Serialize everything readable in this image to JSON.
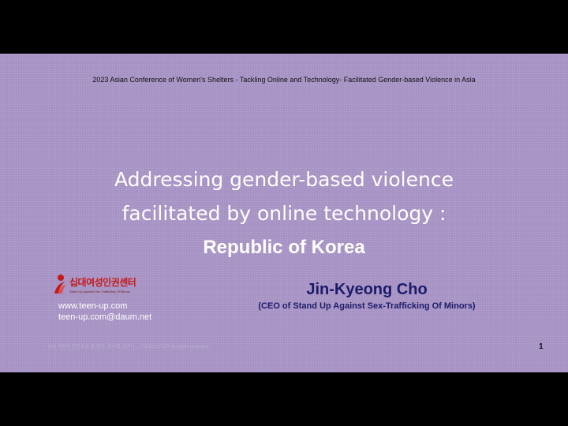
{
  "slide": {
    "conference_title": "2023 Asian Conference of Women's Shelters - Tackling Online and Technology- Facilitated Gender-based Violence in Asia",
    "title_lines": [
      "Addressing gender-based violence",
      "facilitated by online technology :",
      "Republic of Korea"
    ],
    "logo": {
      "name": "십대여성인권센터",
      "tagline": "Stand Up Against Sex-Trafficking Of Minors"
    },
    "links": [
      "www.teen-up.com",
      "teen-up.com@daum.net"
    ],
    "presenter": {
      "name": "Jin-Kyeong Cho",
      "role": "(CEO of Stand Up Against Sex-Trafficking Of Minors)"
    },
    "copyright": "* 십대 여성의 인권보호 및 증진, 유나호 유엔나... Ⓒ2023 STCP All rights reserved",
    "slide_number": "1"
  },
  "colors": {
    "slide_background": "#a995c6",
    "letterbox": "#000000",
    "title_text": "#ffffff",
    "presenter_text": "#1b1b6a",
    "logo_red": "#c41a1a"
  },
  "icons": {
    "logo": "organization-logo-icon"
  }
}
